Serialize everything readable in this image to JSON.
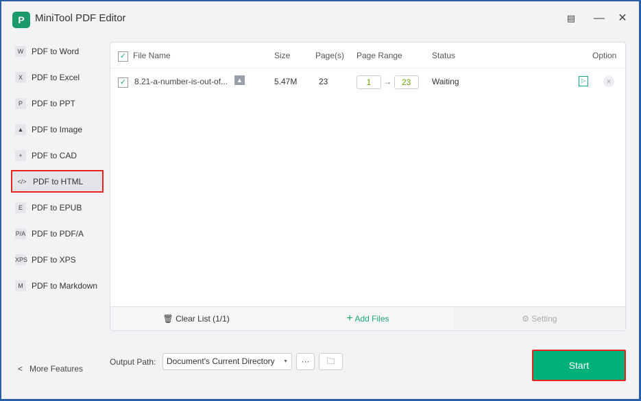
{
  "app": {
    "title": "MiniTool PDF Editor",
    "logo_text": "P"
  },
  "window_controls": [
    "history-icon",
    "minimize-icon",
    "close-icon"
  ],
  "sidebar": {
    "items": [
      {
        "icon": "W",
        "label": "PDF to Word"
      },
      {
        "icon": "X",
        "label": "PDF to Excel"
      },
      {
        "icon": "P",
        "label": "PDF to PPT"
      },
      {
        "icon": "▲",
        "label": "PDF to Image"
      },
      {
        "icon": "+",
        "label": "PDF to CAD"
      },
      {
        "icon": "</>",
        "label": "PDF to HTML",
        "active": true
      },
      {
        "icon": "E",
        "label": "PDF to EPUB"
      },
      {
        "icon": "P/A",
        "label": "PDF to PDF/A"
      },
      {
        "icon": "XPS",
        "label": "PDF to XPS"
      },
      {
        "icon": "M",
        "label": "PDF to Markdown"
      }
    ],
    "more": "More Features"
  },
  "table": {
    "headers": {
      "name": "File Name",
      "size": "Size",
      "pages": "Page(s)",
      "range": "Page Range",
      "status": "Status",
      "option": "Option"
    },
    "rows": [
      {
        "checked": true,
        "name": "8.21-a-number-is-out-of...",
        "size": "5.47M",
        "pages": "23",
        "from": "1",
        "to": "23",
        "status": "Waiting"
      }
    ]
  },
  "toolbar": {
    "clear": "Clear List (1/1)",
    "add": "Add Files",
    "setting": "Setting"
  },
  "output": {
    "label": "Output Path:",
    "value": "Document's Current Directory",
    "more": "···"
  },
  "start": "Start",
  "colors": {
    "accent": "#00b07a",
    "highlight": "#e8231f"
  }
}
